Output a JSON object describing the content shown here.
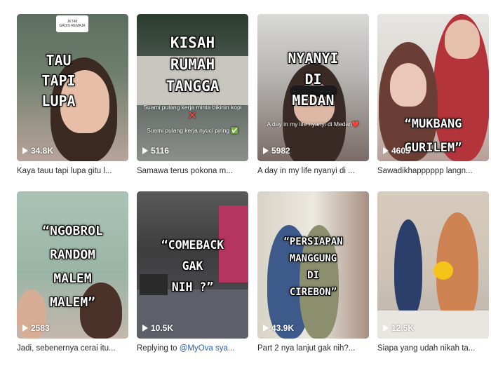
{
  "videos": [
    {
      "overlay": "TAU\nTAPI\nLUPA",
      "sub": "",
      "sticker": "JKT48\nGADIS REMAJA",
      "views": "34.8K",
      "caption": "Kaya tauu tapi lupa gitu l..."
    },
    {
      "overlay": "KISAH\nRUMAH\nTANGGA",
      "sub": "Suami pulang kerja minta bikinin kopi ❌\n\nSuami pulang kerja nyuci piring ✅",
      "views": "5116",
      "caption": "Samawa terus pokona m..."
    },
    {
      "overlay": "NYANYI\nDI\nMEDAN",
      "sub": "A day in my life nyanyi di Medan❤️",
      "views": "5982",
      "caption": "A day in my life nyanyi di ..."
    },
    {
      "overlay": "“MUKBANG\nGURILEM”",
      "sub": "",
      "views": "4605",
      "caption": "Sawadikhapppppp langn..."
    },
    {
      "overlay": "“NGOBROL\nRANDOM\nMALEM\nMALEM”",
      "sub": "",
      "views": "2583",
      "caption": "Jadi, sebenernya cerai itu..."
    },
    {
      "overlay": "“COMEBACK\nGAK\nNIH ?”",
      "sub": "",
      "views": "10.5K",
      "caption_prefix": "Replying to ",
      "caption_mention": "@MyOva sya..."
    },
    {
      "overlay": "“PERSIAPAN\nMANGGUNG\nDI\nCIREBON”",
      "sub": "",
      "views": "43.9K",
      "caption": "Part 2 nya lanjut gak nih?..."
    },
    {
      "overlay": "",
      "sub": "",
      "views": "12.5K",
      "caption": "Siapa yang udah nikah ta..."
    }
  ]
}
